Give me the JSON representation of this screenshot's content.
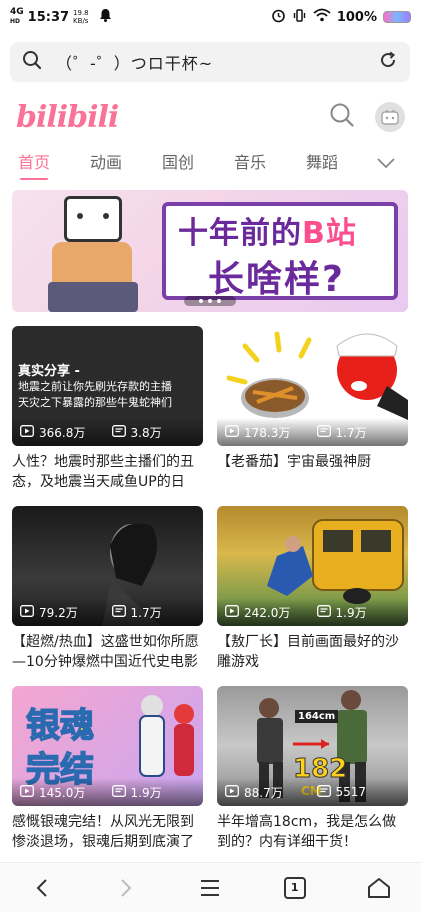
{
  "status_bar": {
    "network": "4G",
    "network_sub": "HD",
    "time": "15:37",
    "speed": "19.8 KB/s",
    "battery": "100%"
  },
  "address_bar": {
    "query": "（゜-゜）つロ干杯~"
  },
  "header": {
    "logo": "bilibili"
  },
  "tabs": [
    {
      "label": "首页",
      "active": true
    },
    {
      "label": "动画"
    },
    {
      "label": "国创"
    },
    {
      "label": "音乐"
    },
    {
      "label": "舞蹈"
    }
  ],
  "banner": {
    "line1_a": "十年前的",
    "line1_b": "B站",
    "line2": "长啥样?"
  },
  "videos": [
    {
      "views": "366.8万",
      "danmaku": "3.8万",
      "title": "人性？地震时那些主播们的丑态，及地震当天咸鱼UP的日",
      "thumb_title": "真实分享 -",
      "thumb_line1": "地震之前让你先刷光存款的主播",
      "thumb_line2": "天灾之下暴露的那些牛鬼蛇神们"
    },
    {
      "views": "178.3万",
      "danmaku": "1.7万",
      "title": "【老番茄】宇宙最强神厨"
    },
    {
      "views": "79.2万",
      "danmaku": "1.7万",
      "title": "【超燃/热血】这盛世如你所愿—10分钟爆燃中国近代史电影"
    },
    {
      "views": "242.0万",
      "danmaku": "1.9万",
      "title": "【敖厂长】目前画面最好的沙雕游戏"
    },
    {
      "views": "145.0万",
      "danmaku": "1.9万",
      "title": "感慨银魂完结！从风光无限到惨淡退场，银魂后期到底演了",
      "thumb_a": "银魂",
      "thumb_b": "完结"
    },
    {
      "views": "88.7万",
      "danmaku": "5517",
      "title": "半年增高18cm，我是怎么做到的？内有详细干货！",
      "thumb_a": "164cm",
      "thumb_b": "182",
      "thumb_c": "CM"
    }
  ],
  "bottom_nav": {
    "tab_count": "1"
  },
  "colors": {
    "accent": "#fb7299"
  }
}
